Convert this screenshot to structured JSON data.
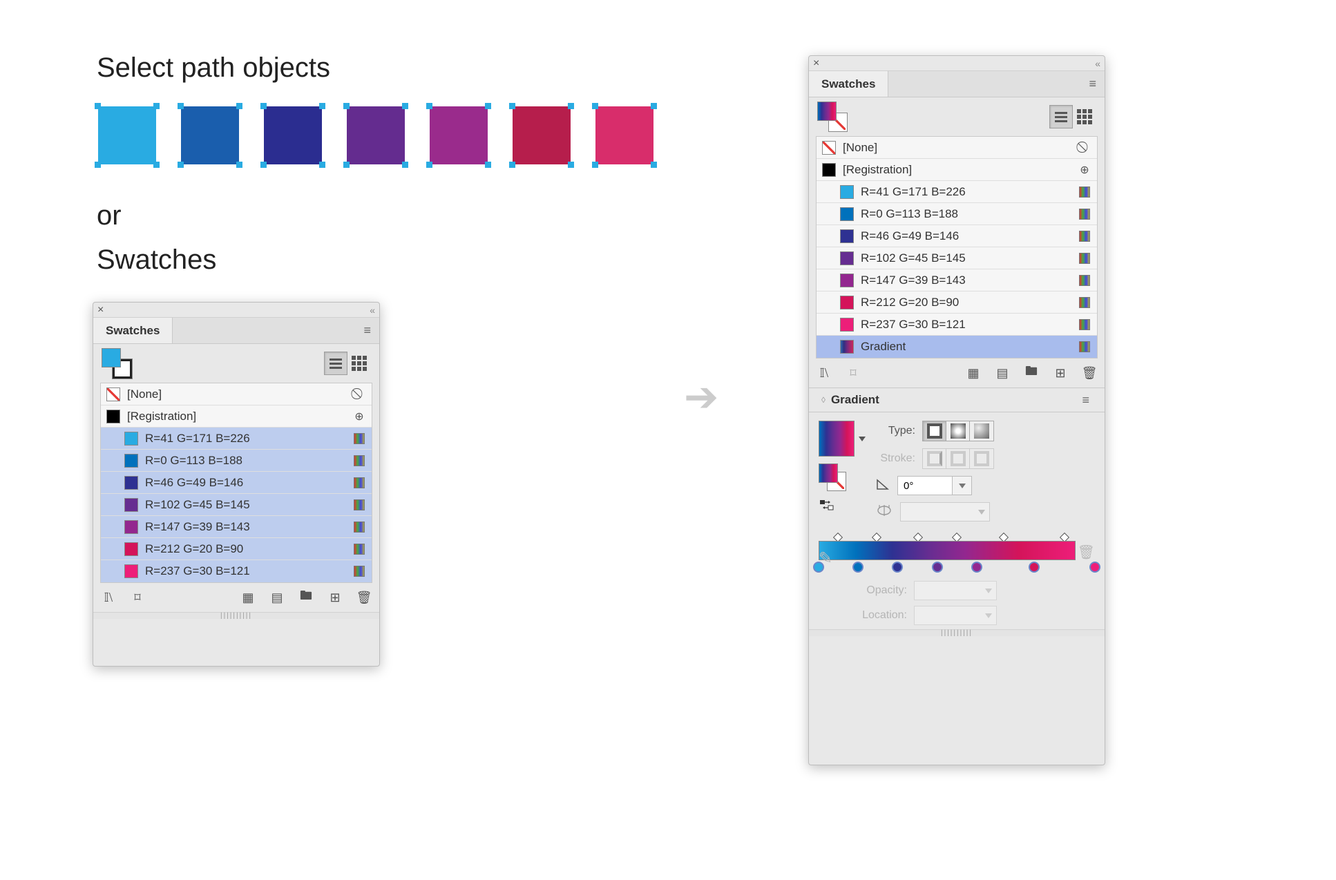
{
  "headings": {
    "select_path": "Select path objects",
    "or": "or",
    "swatches": "Swatches"
  },
  "colors": {
    "squares": [
      "#29abe2",
      "#1a5ead",
      "#2b2d90",
      "#642c8f",
      "#9a2b8c",
      "#b61e4c",
      "#d82d6b"
    ]
  },
  "panel_left": {
    "tab": "Swatches",
    "fill_preview_color": "#29abe2",
    "list": {
      "none": "[None]",
      "registration": "[Registration]",
      "items": [
        {
          "label": "R=41 G=171 B=226",
          "color": "#29abe2",
          "sel": true
        },
        {
          "label": "R=0 G=113 B=188",
          "color": "#0071bc",
          "sel": true
        },
        {
          "label": "R=46 G=49 B=146",
          "color": "#2e3192",
          "sel": true
        },
        {
          "label": "R=102 G=45 B=145",
          "color": "#662d91",
          "sel": true
        },
        {
          "label": "R=147 G=39 B=143",
          "color": "#93278f",
          "sel": true
        },
        {
          "label": "R=212 G=20 B=90",
          "color": "#d4145a",
          "sel": true
        },
        {
          "label": "R=237 G=30 B=121",
          "color": "#ed1e79",
          "sel": true
        }
      ]
    }
  },
  "panel_right": {
    "tab": "Swatches",
    "fill_preview_gradient": "linear-gradient(90deg,#0071bc,#2e3192,#662d91,#93278f,#d4145a,#ed1e79)",
    "list": {
      "none": "[None]",
      "registration": "[Registration]",
      "items": [
        {
          "label": "R=41 G=171 B=226",
          "color": "#29abe2"
        },
        {
          "label": "R=0 G=113 B=188",
          "color": "#0071bc"
        },
        {
          "label": "R=46 G=49 B=146",
          "color": "#2e3192"
        },
        {
          "label": "R=102 G=45 B=145",
          "color": "#662d91"
        },
        {
          "label": "R=147 G=39 B=143",
          "color": "#93278f"
        },
        {
          "label": "R=212 G=20 B=90",
          "color": "#d4145a"
        },
        {
          "label": "R=237 G=30 B=121",
          "color": "#ed1e79"
        }
      ],
      "gradient_label": "Gradient"
    }
  },
  "gradient_panel": {
    "title": "Gradient",
    "type_label": "Type:",
    "stroke_label": "Stroke:",
    "angle_value": "0°",
    "opacity_label": "Opacity:",
    "location_label": "Location:",
    "stops": [
      {
        "pos": 0,
        "color": "#29abe2"
      },
      {
        "pos": 14.3,
        "color": "#0071bc"
      },
      {
        "pos": 28.6,
        "color": "#2e3192"
      },
      {
        "pos": 42.9,
        "color": "#662d91"
      },
      {
        "pos": 57.2,
        "color": "#93278f"
      },
      {
        "pos": 78,
        "color": "#d4145a"
      },
      {
        "pos": 100,
        "color": "#ed1e79"
      }
    ],
    "midpoints": [
      7,
      21,
      36,
      50,
      67,
      89
    ]
  }
}
